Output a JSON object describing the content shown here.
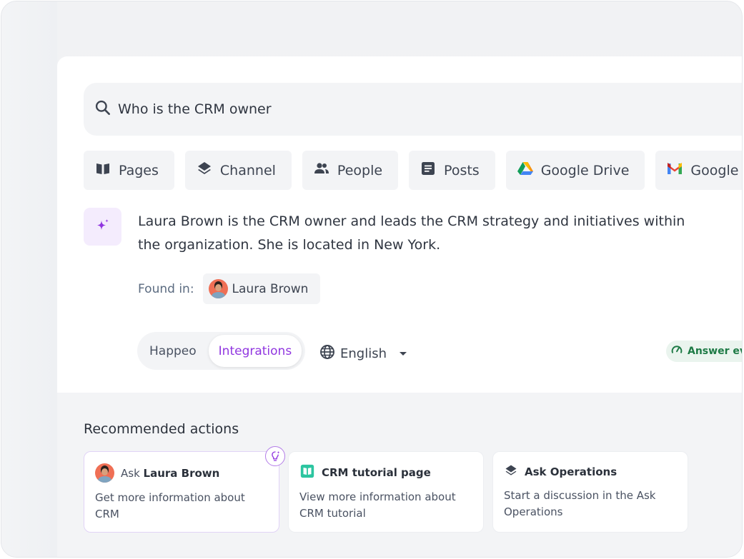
{
  "search": {
    "query": "Who is the CRM owner",
    "icon": "search-icon"
  },
  "filters": [
    {
      "label": "Pages",
      "icon": "book-icon"
    },
    {
      "label": "Channel",
      "icon": "layers-icon"
    },
    {
      "label": "People",
      "icon": "people-icon"
    },
    {
      "label": "Posts",
      "icon": "document-icon"
    },
    {
      "label": "Google Drive",
      "icon": "google-drive-icon"
    },
    {
      "label": "Google",
      "icon": "gmail-icon"
    }
  ],
  "answer": {
    "icon": "sparkle-icon",
    "text": "Laura Brown is the CRM owner and leads the CRM strategy and initiatives within the organization. She is located in New York.",
    "found_in_label": "Found in:",
    "source": {
      "name": "Laura Brown",
      "icon": "avatar"
    }
  },
  "source_toggle": {
    "options": [
      "Happeo",
      "Integrations"
    ],
    "selected": "Integrations"
  },
  "language": {
    "selected": "English",
    "icon": "globe-icon"
  },
  "evaluation_badge": {
    "label": "Answer ev",
    "icon": "gauge-icon",
    "color": "#1d7a45"
  },
  "recommended": {
    "title": "Recommended actions",
    "cards": [
      {
        "prefix": "Ask",
        "title": "Laura Brown",
        "description": "Get more information about CRM",
        "icon": "avatar",
        "highlighted": true,
        "badge_icon": "lightbulb-sparkle-icon"
      },
      {
        "prefix": "",
        "title": "CRM tutorial page",
        "description": "View more information about CRM tutorial",
        "icon": "book-icon"
      },
      {
        "prefix": "",
        "title": "Ask Operations",
        "description": "Start a discussion in the Ask Operations",
        "icon": "layers-icon"
      }
    ]
  },
  "colors": {
    "accent_purple": "#9035e0",
    "ai_icon_bg": "#f4ecfd",
    "eval_green": "#1d7a45",
    "tutorial_teal": "#2cc5a0"
  }
}
